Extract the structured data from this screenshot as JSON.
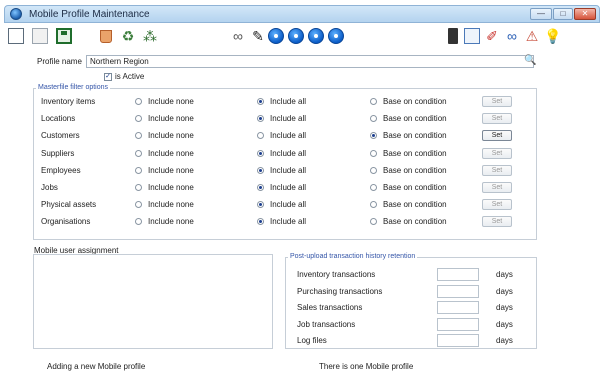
{
  "window": {
    "title": "Mobile Profile Maintenance",
    "controls": [
      "—",
      "□",
      "✕"
    ]
  },
  "toolbar": {
    "icons": [
      "new-document-icon",
      "copy-document-icon",
      "save-icon",
      "delete-icon",
      "refresh-icon",
      "tree-icon",
      "search-binoculars-icon",
      "edit-pen-icon",
      "first-record-icon",
      "previous-record-icon",
      "next-record-icon",
      "last-record-icon",
      "report-icon",
      "note-icon",
      "attachment-icon",
      "link-icon",
      "warning-icon",
      "help-bulb-icon"
    ]
  },
  "profile": {
    "name_label": "Profile name",
    "name_value": "Northern Region",
    "is_active_label": "is Active",
    "is_active_checked": true
  },
  "masterfile": {
    "legend": "Masterfile filter options",
    "option_none": "Include none",
    "option_all": "Include all",
    "option_condition": "Base on condition",
    "set_label": "Set",
    "rows": [
      {
        "label": "Inventory items",
        "selected": "all",
        "set_enabled": false
      },
      {
        "label": "Locations",
        "selected": "all",
        "set_enabled": false
      },
      {
        "label": "Customers",
        "selected": "condition",
        "set_enabled": true
      },
      {
        "label": "Suppliers",
        "selected": "all",
        "set_enabled": false
      },
      {
        "label": "Employees",
        "selected": "all",
        "set_enabled": false
      },
      {
        "label": "Jobs",
        "selected": "all",
        "set_enabled": false
      },
      {
        "label": "Physical assets",
        "selected": "all",
        "set_enabled": false
      },
      {
        "label": "Organisations",
        "selected": "all",
        "set_enabled": false
      }
    ]
  },
  "assignment": {
    "label": "Mobile user assignment"
  },
  "retention": {
    "legend": "Post-upload transaction history retention",
    "unit": "days",
    "rows": [
      {
        "label": "Inventory transactions",
        "value": ""
      },
      {
        "label": "Purchasing transactions",
        "value": ""
      },
      {
        "label": "Sales transactions",
        "value": ""
      },
      {
        "label": "Job transactions",
        "value": ""
      },
      {
        "label": "Log files",
        "value": ""
      }
    ]
  },
  "status": {
    "left": "Adding a new Mobile profile",
    "right": "There is one Mobile profile"
  }
}
